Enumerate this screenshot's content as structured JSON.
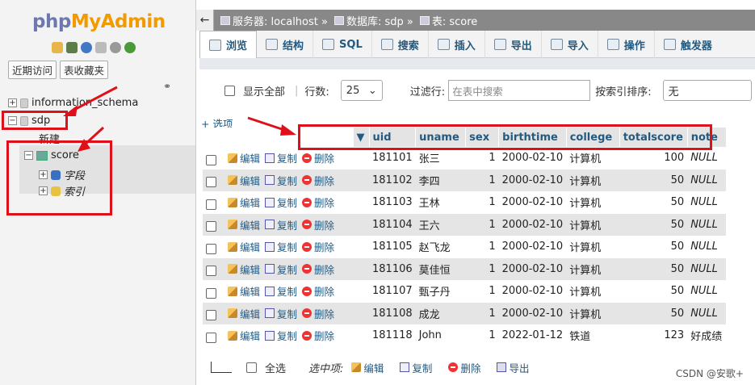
{
  "app": {
    "logo_php": "php",
    "logo_myadmin": "MyAdmin"
  },
  "left": {
    "quick": [
      "近期访问",
      "表收藏夹"
    ],
    "tree": {
      "info_schema": "information_schema",
      "sdp": "sdp",
      "new": "新建",
      "score": "score",
      "fields": "字段",
      "indexes": "索引"
    }
  },
  "breadcrumb": {
    "back": "←",
    "server": "服务器: localhost »",
    "database": "数据库: sdp »",
    "table": "表: score"
  },
  "tabs": [
    {
      "label": "浏览",
      "active": true
    },
    {
      "label": "结构"
    },
    {
      "label": "SQL"
    },
    {
      "label": "搜索"
    },
    {
      "label": "插入"
    },
    {
      "label": "导出"
    },
    {
      "label": "导入"
    },
    {
      "label": "操作"
    },
    {
      "label": "触发器"
    }
  ],
  "filter": {
    "show_all": "显示全部",
    "rows_label": "行数:",
    "rows_value": "25",
    "filter_label": "过滤行:",
    "filter_placeholder": "在表中搜索",
    "sort_label": "按索引排序:",
    "sort_value": "无"
  },
  "options_link": "+ 选项",
  "columns": [
    "uid",
    "uname",
    "sex",
    "birthtime",
    "college",
    "totalscore",
    "note"
  ],
  "actions": {
    "edit": "编辑",
    "copy": "复制",
    "delete": "删除"
  },
  "rows": [
    {
      "uid": "181101",
      "uname": "张三",
      "sex": "1",
      "birthtime": "2000-02-10",
      "college": "计算机",
      "totalscore": "100",
      "note": "NULL"
    },
    {
      "uid": "181102",
      "uname": "李四",
      "sex": "1",
      "birthtime": "2000-02-10",
      "college": "计算机",
      "totalscore": "50",
      "note": "NULL"
    },
    {
      "uid": "181103",
      "uname": "王林",
      "sex": "1",
      "birthtime": "2000-02-10",
      "college": "计算机",
      "totalscore": "50",
      "note": "NULL"
    },
    {
      "uid": "181104",
      "uname": "王六",
      "sex": "1",
      "birthtime": "2000-02-10",
      "college": "计算机",
      "totalscore": "50",
      "note": "NULL"
    },
    {
      "uid": "181105",
      "uname": "赵飞龙",
      "sex": "1",
      "birthtime": "2000-02-10",
      "college": "计算机",
      "totalscore": "50",
      "note": "NULL"
    },
    {
      "uid": "181106",
      "uname": "莫佳恒",
      "sex": "1",
      "birthtime": "2000-02-10",
      "college": "计算机",
      "totalscore": "50",
      "note": "NULL"
    },
    {
      "uid": "181107",
      "uname": "甄子丹",
      "sex": "1",
      "birthtime": "2000-02-10",
      "college": "计算机",
      "totalscore": "50",
      "note": "NULL"
    },
    {
      "uid": "181108",
      "uname": "成龙",
      "sex": "1",
      "birthtime": "2000-02-10",
      "college": "计算机",
      "totalscore": "50",
      "note": "NULL"
    },
    {
      "uid": "181118",
      "uname": "John",
      "sex": "1",
      "birthtime": "2022-01-12",
      "college": "铁道",
      "totalscore": "123",
      "note": "好成绩"
    }
  ],
  "bottom": {
    "select_all": "全选",
    "selected_label": "选中项:",
    "edit": "编辑",
    "copy": "复制",
    "delete": "删除",
    "export": "导出"
  },
  "watermark": "CSDN @安歌+",
  "colors": {
    "highlight_red": "#e0101a",
    "link_blue": "#235a81",
    "row_alt": "#e5e5e5"
  }
}
